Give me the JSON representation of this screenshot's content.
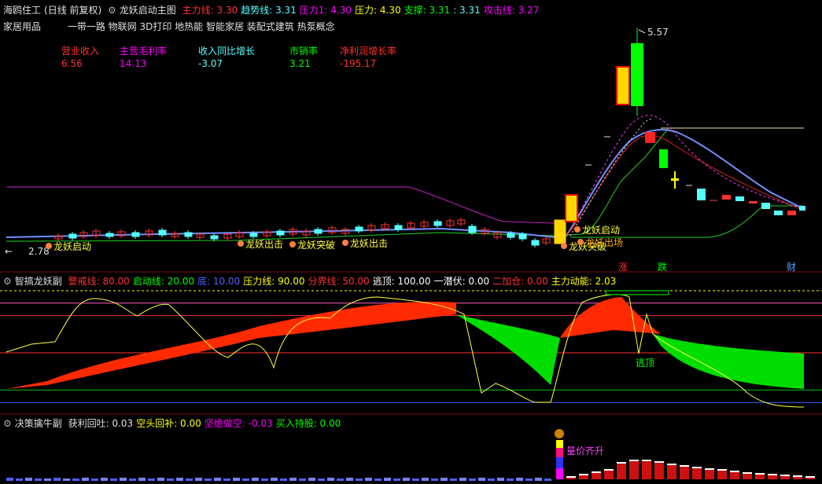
{
  "colors": {
    "red": "#ff3232",
    "green": "#00ff00",
    "cyan": "#54ffff",
    "magenta": "#ff00ff",
    "yellow": "#ffff00",
    "white": "#e0e0e0",
    "blue": "#5060ff",
    "grey": "#8a8a8a"
  },
  "main": {
    "stock_name": "海鸥住工",
    "period": "(日线 前复权)",
    "indicator_name": "龙妖启动主图",
    "params": [
      {
        "label": "主力线:",
        "value": "3.30",
        "color": "#ff3232"
      },
      {
        "label": "趋势线:",
        "value": "3.31",
        "color": "#54ffff"
      },
      {
        "label": "压力1:",
        "value": "4.30",
        "color": "#ff00ff"
      },
      {
        "label": "压力:",
        "value": "4.30",
        "color": "#ffff00"
      },
      {
        "label": "支撑:",
        "value": "3.31",
        "color": "#00ff00"
      },
      {
        "label": ":",
        "value": "3.31",
        "color": "#54ffff"
      },
      {
        "label": "攻击线:",
        "value": "3.27",
        "color": "#ff00ff"
      }
    ],
    "industry": "家居用品",
    "concepts": "一带一路 物联网 3D打印 地热能 智能家居 装配式建筑 热泵概念",
    "fundamentals": [
      {
        "label": "营业收入",
        "value": "6.56",
        "label_color": "#ff3232",
        "value_color": "#ff3232"
      },
      {
        "label": "主营毛利率",
        "value": "14.13",
        "label_color": "#ff00ff",
        "value_color": "#ff00ff"
      },
      {
        "label": "收入同比增长",
        "value": "-3.07",
        "label_color": "#54ffff",
        "value_color": "#54ffff"
      },
      {
        "label": "市销率",
        "value": "3.21",
        "label_color": "#00ff00",
        "value_color": "#00ff00"
      },
      {
        "label": "净利润增长率",
        "value": "-195.17",
        "label_color": "#ff3232",
        "value_color": "#ff3232"
      }
    ],
    "high_label": "5.57",
    "low_label": "2.78",
    "signals": [
      "龙妖启动",
      "龙妖出击",
      "龙妖突破",
      "龙妖出击",
      "龙妖启动",
      "龙妖突破",
      "龙妖出场"
    ],
    "markers": [
      "涨",
      "跌",
      "财"
    ]
  },
  "sub1": {
    "name": "智搞龙妖副",
    "params": [
      {
        "label": "警戒线:",
        "value": "80.00",
        "color": "#ff3232"
      },
      {
        "label": "启动线:",
        "value": "20.00",
        "color": "#00ff00"
      },
      {
        "label": "底:",
        "value": "10.00",
        "color": "#5060ff"
      },
      {
        "label": "压力线:",
        "value": "90.00",
        "color": "#ffff00"
      },
      {
        "label": "分界线:",
        "value": "50.00",
        "color": "#ff3232"
      },
      {
        "label": "逃顶:",
        "value": "100.00",
        "color": "#ffffff"
      },
      {
        "label": "一潜伏:",
        "value": "0.00",
        "color": "#ffffff"
      },
      {
        "label": "二加仓:",
        "value": "0.00",
        "color": "#ff3232"
      },
      {
        "label": "主力动能:",
        "value": "2.03",
        "color": "#ffff00"
      }
    ],
    "escape_label": "逃顶"
  },
  "sub2": {
    "name": "决策擒牛副",
    "params": [
      {
        "label": "获利回吐:",
        "value": "0.03",
        "color": "#e0e0e0"
      },
      {
        "label": "空头回补:",
        "value": "0.00",
        "color": "#ffff00"
      },
      {
        "label": "坚绝做空:",
        "value": "-0.03",
        "color": "#ff00ff"
      },
      {
        "label": "买入持股:",
        "value": "0.00",
        "color": "#00ff00"
      }
    ],
    "annotation": "量价齐升"
  }
}
